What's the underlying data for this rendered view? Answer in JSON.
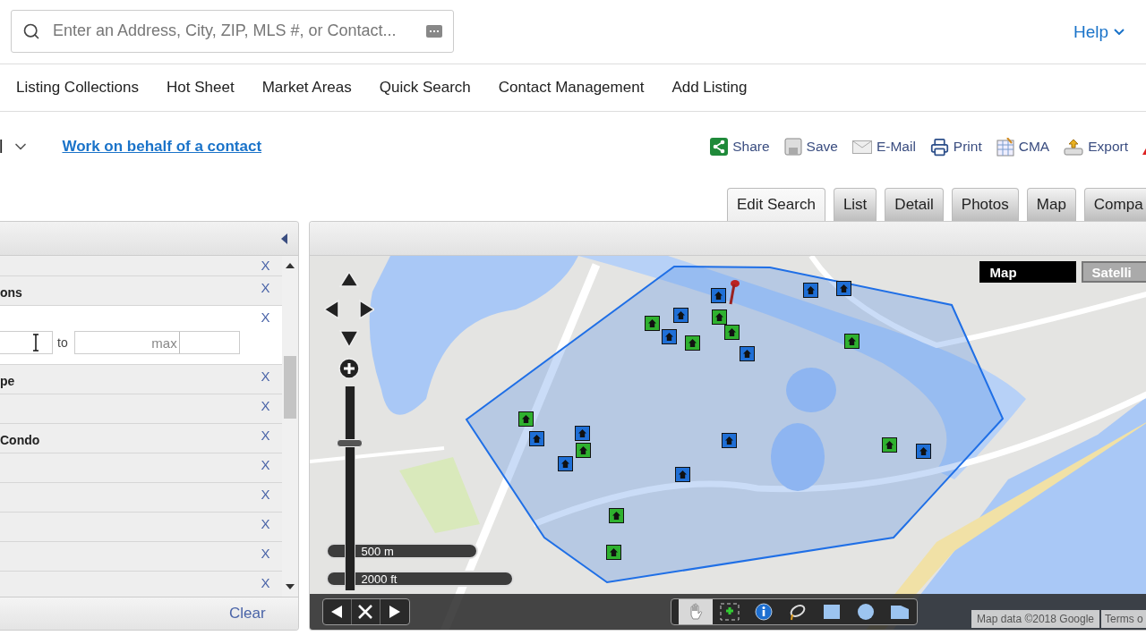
{
  "search": {
    "placeholder": "Enter an Address, City, ZIP, MLS #, or Contact..."
  },
  "help": {
    "label": "Help"
  },
  "nav": [
    {
      "label": "Listing Collections"
    },
    {
      "label": "Hot Sheet"
    },
    {
      "label": "Market Areas"
    },
    {
      "label": "Quick Search"
    },
    {
      "label": "Contact Management"
    },
    {
      "label": "Add Listing"
    }
  ],
  "context": {
    "label": "l",
    "link": "Work on behalf of a contact"
  },
  "actions": [
    {
      "kind": "share",
      "label": "Share"
    },
    {
      "kind": "save",
      "label": "Save"
    },
    {
      "kind": "email",
      "label": "E-Mail"
    },
    {
      "kind": "print",
      "label": "Print"
    },
    {
      "kind": "cma",
      "label": "CMA"
    },
    {
      "kind": "export",
      "label": "Export"
    },
    {
      "kind": "alert"
    }
  ],
  "tabs": [
    {
      "label": "Edit Search",
      "selected": true
    },
    {
      "label": "List",
      "selected": false
    },
    {
      "label": "Detail",
      "selected": false
    },
    {
      "label": "Photos",
      "selected": false
    },
    {
      "label": "Map",
      "selected": false
    },
    {
      "label": "Compa",
      "selected": false
    }
  ],
  "criteria": {
    "rows": [
      {
        "kind": "partial",
        "remove": "X"
      },
      {
        "kind": "field",
        "label": "ons",
        "remove": "X"
      },
      {
        "kind": "range",
        "separator": "to",
        "max_placeholder": "max",
        "remove": "X"
      },
      {
        "kind": "field",
        "label": "pe",
        "remove": "X"
      },
      {
        "kind": "field",
        "remove": "X"
      },
      {
        "kind": "field",
        "label": "Condo",
        "remove": "X"
      },
      {
        "kind": "field",
        "remove": "X"
      },
      {
        "kind": "field",
        "remove": "X"
      },
      {
        "kind": "field",
        "remove": "X"
      },
      {
        "kind": "field",
        "remove": "X"
      },
      {
        "kind": "field",
        "remove": "X"
      }
    ],
    "clear": "Clear"
  },
  "map": {
    "types": [
      {
        "label": "Map",
        "selected": true
      },
      {
        "label": "Satelli",
        "selected": false
      }
    ],
    "zoom": {
      "level": 0.73
    },
    "scale": [
      "500 m",
      "2000 ft"
    ],
    "markers": [
      {
        "color": "#2fb12f"
      },
      {
        "color": "#1f6fd6"
      },
      {
        "color": "#1f6fd6"
      },
      {
        "color": "#2fb12f"
      },
      {
        "color": "#1f6fd6"
      },
      {
        "color": "#2fb12f"
      },
      {
        "color": "#2fb12f"
      },
      {
        "color": "#1f6fd6"
      },
      {
        "color": "#1f6fd6"
      },
      {
        "color": "#1f6fd6"
      },
      {
        "color": "#2fb12f"
      },
      {
        "color": "#2fb12f"
      },
      {
        "color": "#1f6fd6"
      },
      {
        "color": "#1f6fd6"
      },
      {
        "color": "#1f6fd6"
      },
      {
        "color": "#2fb12f"
      },
      {
        "color": "#1f6fd6"
      },
      {
        "color": "#1f6fd6"
      },
      {
        "color": "#2fb12f"
      },
      {
        "color": "#1f6fd6"
      },
      {
        "color": "#2fb12f"
      },
      {
        "color": "#2fb12f"
      }
    ],
    "tools": [
      {
        "kind": "pan",
        "selected": true
      },
      {
        "kind": "zoom-box",
        "selected": false
      },
      {
        "kind": "info",
        "selected": false
      },
      {
        "kind": "lasso",
        "selected": false
      },
      {
        "kind": "rectangle",
        "selected": false
      },
      {
        "kind": "circle",
        "selected": false
      },
      {
        "kind": "polygon",
        "selected": false
      }
    ],
    "attribution": "Map data ©2018 Google",
    "terms": "Terms o"
  }
}
